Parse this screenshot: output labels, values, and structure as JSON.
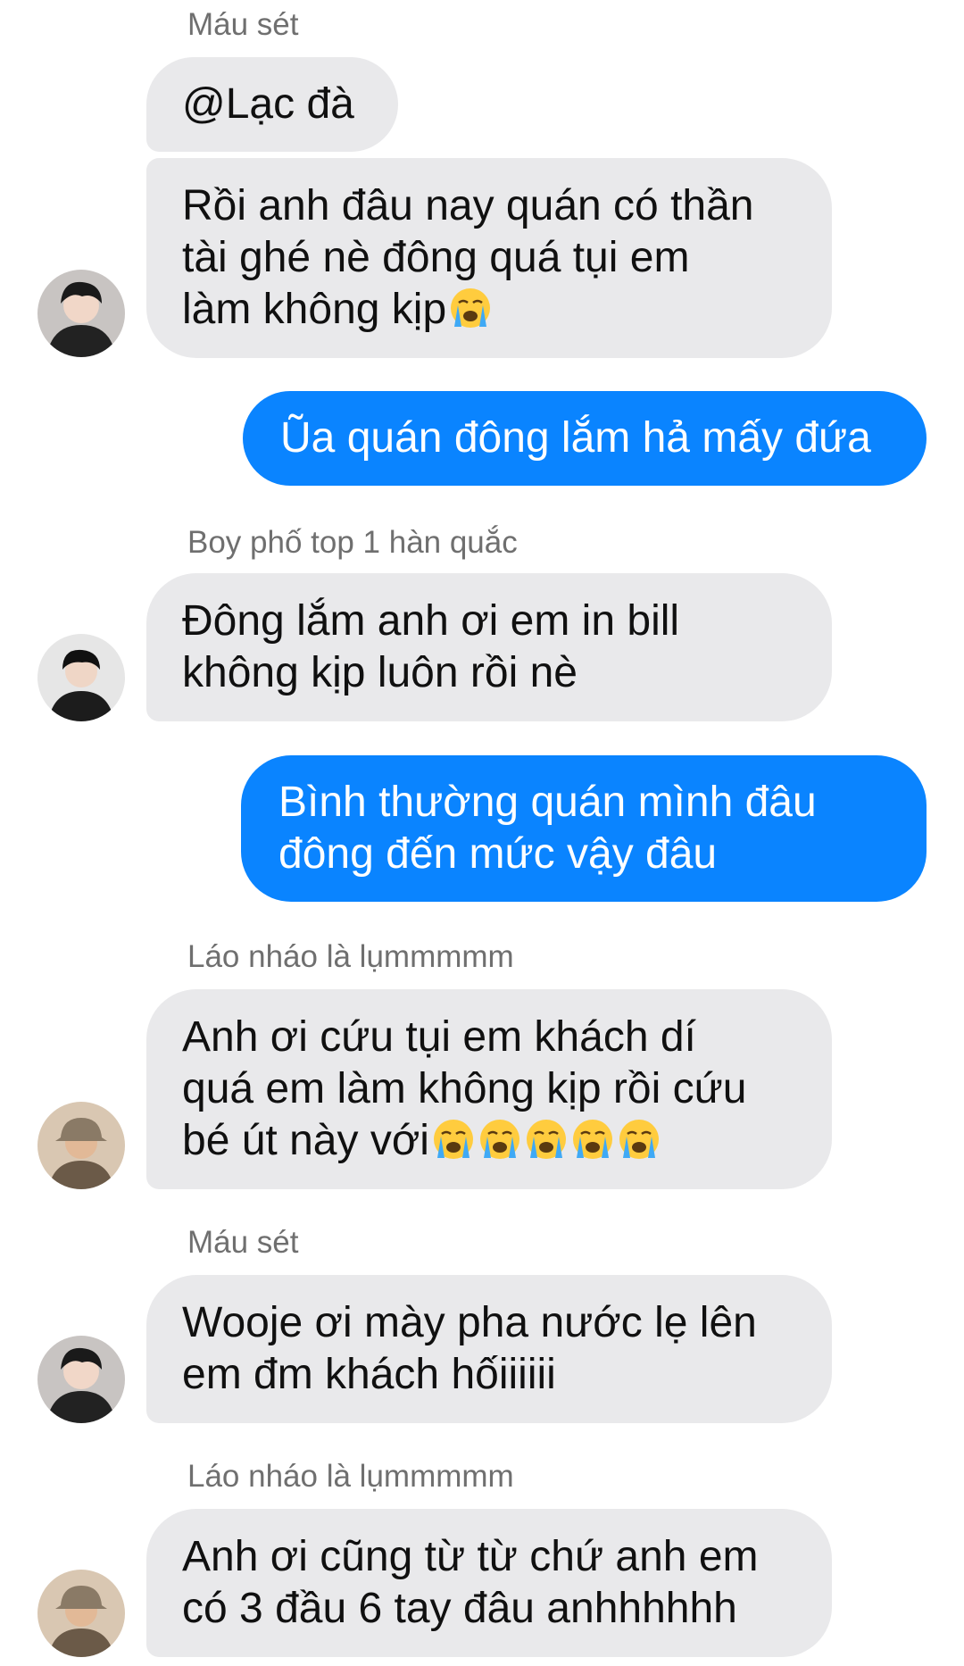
{
  "conversation": {
    "messages": [
      {
        "sender": "Máu sét"
      },
      {
        "text": "@Lạc đà"
      },
      {
        "lines": [
          "Rồi anh đâu nay quán có thần",
          "tài ghé nè đông quá tụi em",
          "làm không kịp"
        ],
        "emoji": "loudly-crying-face"
      },
      {
        "text": "Ũa quán đông lắm hả mấy đứa"
      },
      {
        "sender": "Boy phố top 1 hàn quắc"
      },
      {
        "lines": [
          "Đông lắm anh ơi em in bill",
          "không kịp luôn rồi nè"
        ]
      },
      {
        "lines": [
          "Bình thường quán mình đâu",
          "đông đến mức vậy đâu"
        ]
      },
      {
        "sender": "Láo nháo là lụmmmmm"
      },
      {
        "lines": [
          "Anh ơi cứu tụi em khách dí",
          "quá em làm không kịp rồi cứu",
          "bé út này với"
        ],
        "emoji": "loudly-crying-face",
        "emoji_count": 5
      },
      {
        "sender": "Máu sét"
      },
      {
        "lines": [
          "Wooje ơi mày pha nước lẹ lên",
          "em đm khách hốiiiiii"
        ]
      },
      {
        "sender": "Láo nháo là lụmmmmm"
      },
      {
        "lines": [
          "Anh ơi cũng từ từ chứ anh em",
          "có 3 đầu 6 tay đâu anhhhhhh"
        ]
      }
    ]
  },
  "colors": {
    "incoming_bubble": "#e9e9eb",
    "outgoing_bubble": "#0a84ff",
    "sender_name": "#6f6f6f"
  }
}
